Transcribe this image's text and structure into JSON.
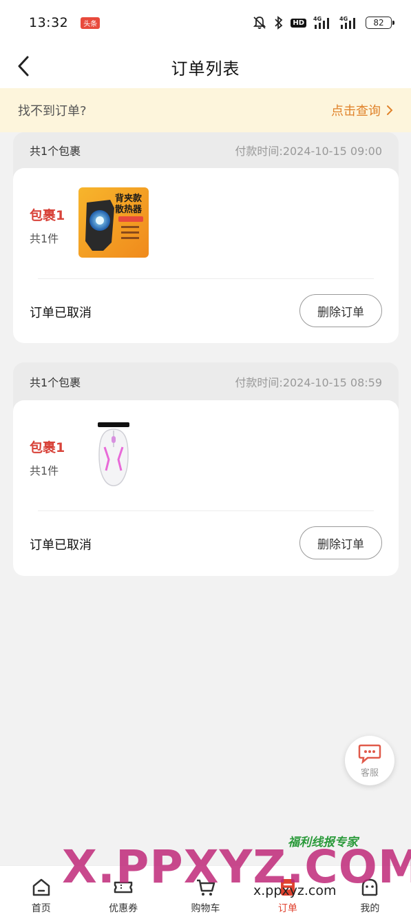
{
  "status_bar": {
    "time": "13:32",
    "badge": "头条",
    "hd_label": "HD",
    "battery": "82",
    "signal_1": "4G",
    "signal_2": "4G"
  },
  "nav": {
    "title": "订单列表"
  },
  "notice": {
    "text": "找不到订单?",
    "link": "点击查询"
  },
  "orders": [
    {
      "package_count": "共1个包裹",
      "pay_time": "付款时间:2024-10-15 09:00",
      "package_label": "包裹1",
      "item_count": "共1件",
      "product_image": "phone-cooler-icon",
      "product_image_text": [
        "背夹款",
        "散热器"
      ],
      "status": "订单已取消",
      "delete_label": "删除订单"
    },
    {
      "package_count": "共1个包裹",
      "pay_time": "付款时间:2024-10-15 08:59",
      "package_label": "包裹1",
      "item_count": "共1件",
      "product_image": "gaming-mouse-icon",
      "status": "订单已取消",
      "delete_label": "删除订单"
    }
  ],
  "service": {
    "label": "客服"
  },
  "watermark": {
    "brand": "X.PPXYZ.COM",
    "url": "x.ppxyz.com",
    "tagline": "福利线报专家"
  },
  "tabs": [
    {
      "label": "首页",
      "icon": "home-icon"
    },
    {
      "label": "优惠券",
      "icon": "coupon-icon"
    },
    {
      "label": "购物车",
      "icon": "cart-icon"
    },
    {
      "label": "订单",
      "icon": "order-icon",
      "active": true
    },
    {
      "label": "我的",
      "icon": "profile-icon"
    }
  ],
  "colors": {
    "accent": "#e0422f",
    "notice_bg": "#fdf5dc",
    "link": "#e0822a",
    "package_label": "#d8433a"
  }
}
